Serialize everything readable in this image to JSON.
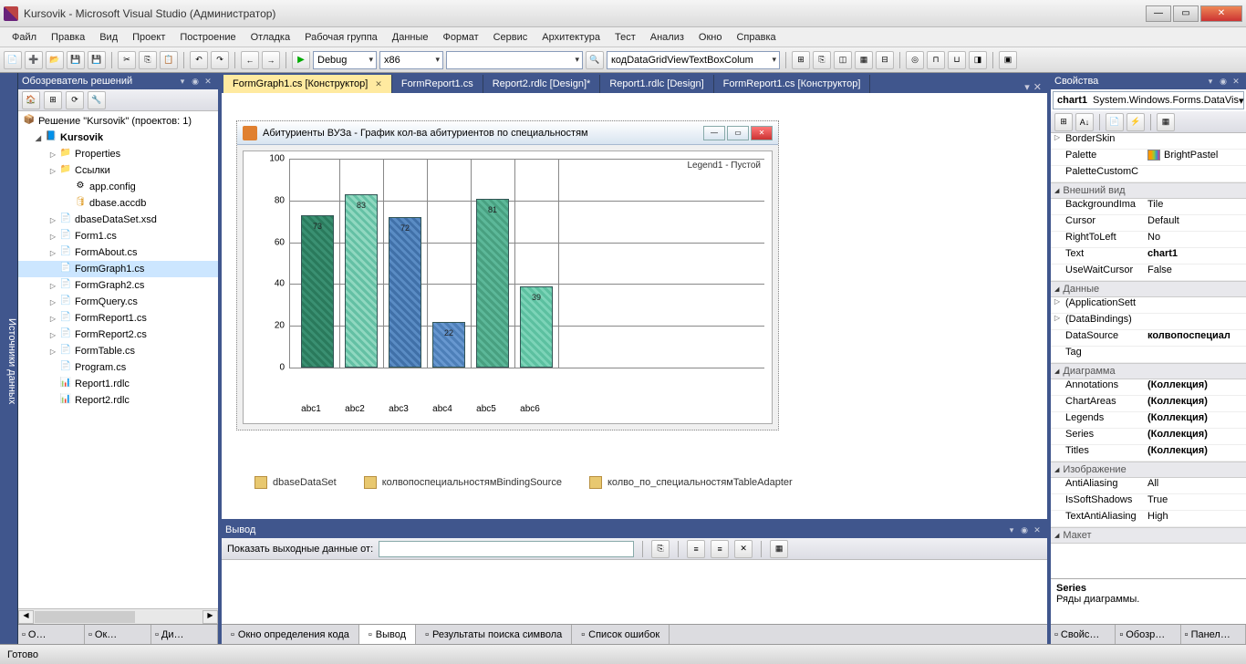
{
  "title": "Kursovik - Microsoft Visual Studio (Администратор)",
  "menu": [
    "Файл",
    "Правка",
    "Вид",
    "Проект",
    "Построение",
    "Отладка",
    "Рабочая группа",
    "Данные",
    "Формат",
    "Сервис",
    "Архитектура",
    "Тест",
    "Анализ",
    "Окно",
    "Справка"
  ],
  "toolbar": {
    "config": "Debug",
    "platform": "x86",
    "search": "кодDataGridViewTextBoxColum"
  },
  "left_rail": "Источники данных",
  "solution_explorer": {
    "title": "Обозреватель решений",
    "root": "Решение \"Kursovik\"  (проектов: 1)",
    "project": "Kursovik",
    "items": [
      {
        "name": "Properties",
        "exp": true,
        "type": "folder"
      },
      {
        "name": "Ссылки",
        "exp": true,
        "type": "folder"
      },
      {
        "name": "app.config",
        "type": "cfg",
        "indent": 3
      },
      {
        "name": "dbase.accdb",
        "type": "db",
        "indent": 3
      },
      {
        "name": "dbaseDataSet.xsd",
        "exp": true,
        "type": "cs"
      },
      {
        "name": "Form1.cs",
        "exp": true,
        "type": "cs"
      },
      {
        "name": "FormAbout.cs",
        "exp": true,
        "type": "cs"
      },
      {
        "name": "FormGraph1.cs",
        "type": "cs",
        "sel": true
      },
      {
        "name": "FormGraph2.cs",
        "exp": true,
        "type": "cs"
      },
      {
        "name": "FormQuery.cs",
        "exp": true,
        "type": "cs"
      },
      {
        "name": "FormReport1.cs",
        "exp": true,
        "type": "cs"
      },
      {
        "name": "FormReport2.cs",
        "exp": true,
        "type": "cs"
      },
      {
        "name": "FormTable.cs",
        "exp": true,
        "type": "cs"
      },
      {
        "name": "Program.cs",
        "type": "cs"
      },
      {
        "name": "Report1.rdlc",
        "type": "rdlc"
      },
      {
        "name": "Report2.rdlc",
        "type": "rdlc"
      }
    ]
  },
  "bl_tabs": [
    "О…",
    "Ок…",
    "Ди…"
  ],
  "doc_tabs": [
    {
      "label": "FormGraph1.cs [Конструктор]",
      "active": true,
      "close": true
    },
    {
      "label": "FormReport1.cs"
    },
    {
      "label": "Report2.rdlc [Design]*"
    },
    {
      "label": "Report1.rdlc [Design]"
    },
    {
      "label": "FormReport1.cs [Конструктор]"
    }
  ],
  "form_caption": "Абитуриенты ВУЗа - График кол-ва абитуриентов по специальностям",
  "legend": "Legend1 - Пустой",
  "chart_data": {
    "type": "bar",
    "categories": [
      "abc1",
      "abc2",
      "abc3",
      "abc4",
      "abc5",
      "abc6"
    ],
    "values": [
      73,
      83,
      72,
      22,
      81,
      39
    ],
    "ylim": [
      0,
      100
    ],
    "yticks": [
      0,
      20,
      40,
      60,
      80,
      100
    ]
  },
  "components": [
    "dbaseDataSet",
    "колвопоспециальностямBindingSource",
    "колво_по_специальностямTableAdapter"
  ],
  "output": {
    "title": "Вывод",
    "label": "Показать выходные данные от:"
  },
  "bc_tabs": [
    {
      "label": "Окно определения кода"
    },
    {
      "label": "Вывод",
      "active": true
    },
    {
      "label": "Результаты поиска символа"
    },
    {
      "label": "Список ошибок"
    }
  ],
  "properties": {
    "title": "Свойства",
    "selected_name": "chart1",
    "selected_type": "System.Windows.Forms.DataVis",
    "rows": [
      {
        "n": "BorderSkin",
        "v": "",
        "exp": true
      },
      {
        "n": "Palette",
        "v": "BrightPastel",
        "swatch": true
      },
      {
        "n": "PaletteCustomC",
        "v": ""
      }
    ],
    "cat2": "Внешний вид",
    "rows2": [
      {
        "n": "BackgroundIma",
        "v": "Tile"
      },
      {
        "n": "Cursor",
        "v": "Default"
      },
      {
        "n": "RightToLeft",
        "v": "No"
      },
      {
        "n": "Text",
        "v": "chart1",
        "bold": true
      },
      {
        "n": "UseWaitCursor",
        "v": "False"
      }
    ],
    "cat3": "Данные",
    "rows3": [
      {
        "n": "(ApplicationSett",
        "v": "",
        "exp": true
      },
      {
        "n": "(DataBindings)",
        "v": "",
        "exp": true
      },
      {
        "n": "DataSource",
        "v": "колвопоспециал",
        "bold": true
      },
      {
        "n": "Tag",
        "v": ""
      }
    ],
    "cat4": "Диаграмма",
    "rows4": [
      {
        "n": "Annotations",
        "v": "(Коллекция)",
        "bold": true
      },
      {
        "n": "ChartAreas",
        "v": "(Коллекция)",
        "bold": true
      },
      {
        "n": "Legends",
        "v": "(Коллекция)",
        "bold": true
      },
      {
        "n": "Series",
        "v": "(Коллекция)",
        "bold": true
      },
      {
        "n": "Titles",
        "v": "(Коллекция)",
        "bold": true
      }
    ],
    "cat5": "Изображение",
    "rows5": [
      {
        "n": "AntiAliasing",
        "v": "All"
      },
      {
        "n": "IsSoftShadows",
        "v": "True"
      },
      {
        "n": "TextAntiAliasing",
        "v": "High"
      }
    ],
    "cat6": "Макет",
    "help_name": "Series",
    "help_desc": "Ряды диаграммы."
  },
  "br_tabs": [
    "Свойс…",
    "Обозр…",
    "Панел…"
  ],
  "status": "Готово"
}
